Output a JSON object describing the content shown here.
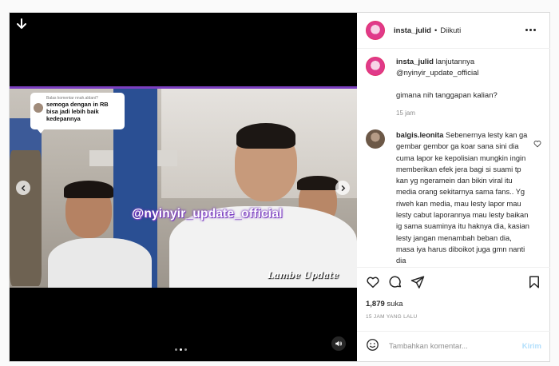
{
  "header": {
    "username": "insta_julid",
    "separator": "•",
    "follow_status": "Diikuti"
  },
  "media": {
    "overlay_comment": {
      "header": "Balas komentar nnah.aldani?",
      "text": "semoga dengan in RB bisa jadi lebih baik kedepannya"
    },
    "watermark": "@nyinyir_update_official",
    "corner_logo": "Lambe Update",
    "carousel": {
      "total": 3,
      "active": 2
    }
  },
  "caption": {
    "username": "insta_julid",
    "text_part1": "lanjutannya",
    "mention": "@nyinyir_update_official",
    "line2": "gimana nih tanggapan kalian?",
    "time": "15 jam"
  },
  "comments": [
    {
      "username": "balgis.leonita",
      "text": "Sebenernya lesty kan ga gembar gembor ga koar sana sini dia cuma lapor ke kepolisian mungkin ingin memberikan efek jera bagi si suami tp kan yg ngeramein dan bikin viral itu media orang sekitarnya sama fans.. Yg riweh kan media, mau lesty lapor mau lesty cabut laporannya mau lesty baikan ig sama suaminya itu haknya dia, kasian lesty jangan menambah beban dia, masa iya harus diboikot juga gmn nanti dia"
    }
  ],
  "actions": {
    "likes_count": "1,879",
    "likes_label": "suka",
    "time_ago": "15 JAM YANG LALU"
  },
  "add_comment": {
    "placeholder": "Tambahkan komentar...",
    "post_label": "Kirim"
  },
  "colors": {
    "accent_purple": "#7b3fbf",
    "link_disabled": "#b2dffc",
    "secondary_text": "#8e8e8e"
  }
}
